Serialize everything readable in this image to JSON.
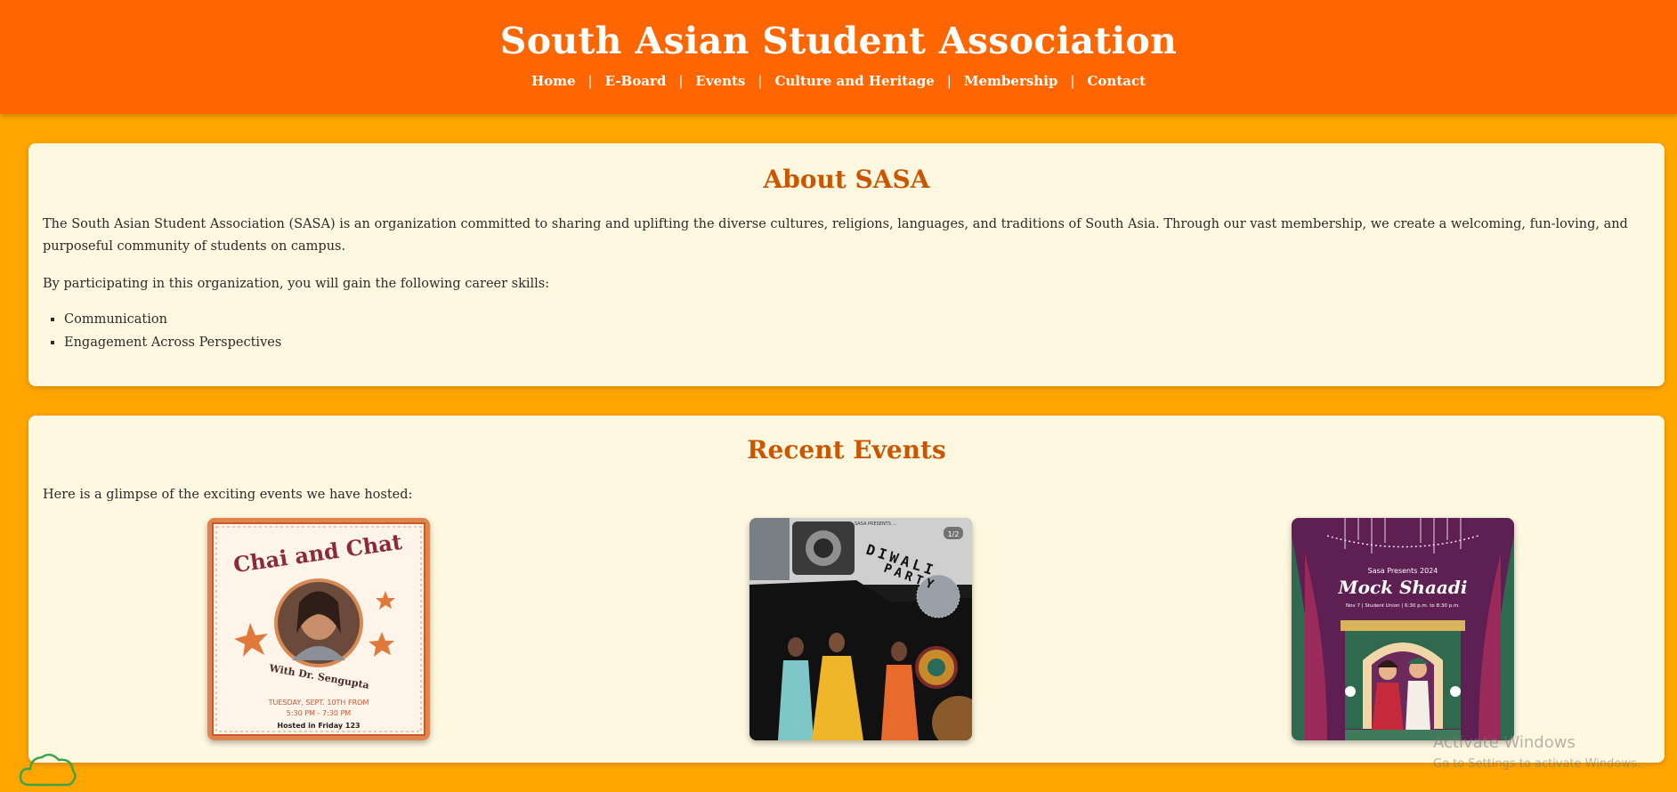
{
  "header": {
    "title": "South Asian Student Association",
    "nav": [
      {
        "label": "Home"
      },
      {
        "label": "E-Board"
      },
      {
        "label": "Events"
      },
      {
        "label": "Culture and Heritage"
      },
      {
        "label": "Membership"
      },
      {
        "label": "Contact"
      }
    ],
    "separator": "|"
  },
  "about": {
    "title": "About SASA",
    "paragraph1": "The South Asian Student Association (SASA) is an organization committed to sharing and uplifting the diverse cultures, religions, languages, and traditions of South Asia. Through our vast membership, we create a welcoming, fun-loving, and purposeful community of students on campus.",
    "paragraph2": "By participating in this organization, you will gain the following career skills:",
    "skills": [
      "Communication",
      "Engagement Across Perspectives"
    ]
  },
  "events": {
    "title": "Recent Events",
    "intro": "Here is a glimpse of the exciting events we have hosted:",
    "poster1": {
      "title_line1": "Chai and Chat",
      "subtitle": "With Dr. Sengupta",
      "date": "TUESDAY, SEPT. 10TH FROM",
      "time": "5:30 PM - 7:30 PM",
      "location": "Hosted in Friday 123"
    },
    "poster2": {
      "caption": "SASA PRESENTS ...",
      "word1": "DIWALI",
      "word2": "PARTY",
      "counter": "1/2"
    },
    "poster3": {
      "line1": "Sasa Presents 2024",
      "title": "Mock Shaadi",
      "details": "Nov 7 | Student Union | 6:30 p.m. to 8:30 p.m."
    }
  },
  "os_overlay": {
    "line1": "Activate Windows",
    "line2": "Go to Settings to activate Windows."
  },
  "colors": {
    "page_bg": "#ffa500",
    "header_bg": "#ff6600",
    "card_bg": "#fff8e1",
    "heading": "#cc5500"
  }
}
